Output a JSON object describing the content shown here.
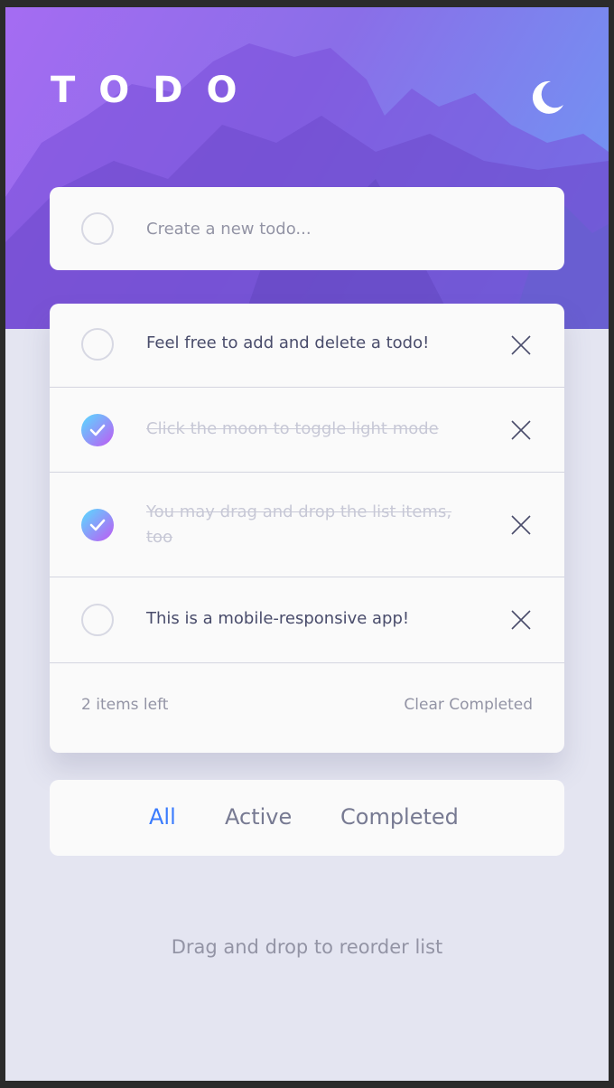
{
  "header": {
    "title": "TODO",
    "theme_toggle_icon": "moon-icon"
  },
  "new_todo": {
    "placeholder": "Create a new todo..."
  },
  "todos": [
    {
      "text": "Feel free to add and delete a todo!",
      "completed": false
    },
    {
      "text": "Click the moon to toggle light mode",
      "completed": true
    },
    {
      "text": "You may drag and drop the list items, too",
      "completed": true
    },
    {
      "text": "This is a mobile-responsive app!",
      "completed": false
    }
  ],
  "footer": {
    "items_left": "2 items left",
    "clear_label": "Clear Completed"
  },
  "filters": [
    {
      "label": "All",
      "active": true
    },
    {
      "label": "Active",
      "active": false
    },
    {
      "label": "Completed",
      "active": false
    }
  ],
  "hint": "Drag and drop to reorder list",
  "colors": {
    "accent": "#3a7bfd",
    "check_gradient_start": "#57ddff",
    "check_gradient_end": "#c058f3",
    "background": "#e4e5f1",
    "card": "#fafafa"
  }
}
